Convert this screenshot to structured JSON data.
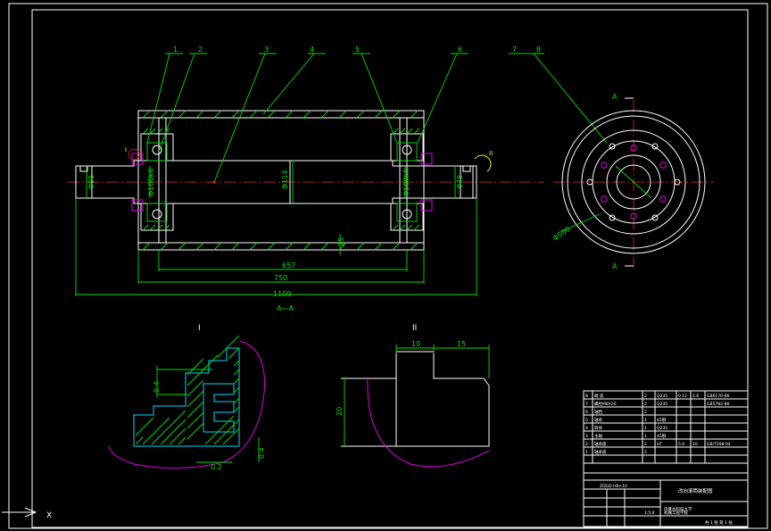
{
  "balloons": [
    "1",
    "2",
    "3",
    "4",
    "5",
    "6",
    "7",
    "8"
  ],
  "section_views": {
    "main": "A—A",
    "detail_1": "I",
    "detail_2": "II"
  },
  "section_marks": {
    "a_top": "A",
    "a_bottom": "A",
    "detail_1_mark": "I",
    "detail_2_mark": "II"
  },
  "dimensions": {
    "shaft_left": "Φ55",
    "bearing_left": "Φ100k6",
    "shaft_mid": "Φ114",
    "bearing_right": "Φ100k6",
    "shaft_right": "Φ45",
    "thickness": "25",
    "inner_len": "657",
    "drum_len": "750",
    "total_len": "1109",
    "drum_dia": "Φ500",
    "detail_1_height": "0.4",
    "detail_1_gap": "0.2",
    "detail_1_right": "0.4",
    "detail_2_w1": "10",
    "detail_2_w2": "15",
    "detail_2_h": "20"
  },
  "title_block": {
    "rows": [
      [
        "8",
        "端 盖",
        "2",
        "Q235",
        "0.12",
        "2.6",
        "GB6170-86"
      ],
      [
        "7",
        "螺栓M8X20",
        "2",
        "Q235",
        "",
        "",
        "GB5782-86"
      ],
      [
        "6",
        "轴档",
        "2",
        "",
        "",
        "",
        ""
      ],
      [
        "5",
        "轴承",
        "1",
        "45钢",
        "",
        "",
        ""
      ],
      [
        "4",
        "筒体",
        "1",
        "Q235",
        "",
        "",
        ""
      ],
      [
        "3",
        "主轴",
        "1",
        "45钢",
        "",
        "",
        ""
      ],
      [
        "2",
        "轴承座",
        "2",
        "HT",
        "5.0",
        "10",
        "GB/T298-94"
      ],
      [
        "1",
        "轴承盖",
        "2",
        "",
        "",
        "",
        ""
      ]
    ],
    "drawing_title": "改向滚筒装配图",
    "drawing_code": "ZDGD-H8×10",
    "scale": "1:5.0",
    "school": "内蒙古科技大学",
    "department": "机械工程学院",
    "sheet": "共 1 张 第 1 张"
  },
  "ucs_label": "X"
}
